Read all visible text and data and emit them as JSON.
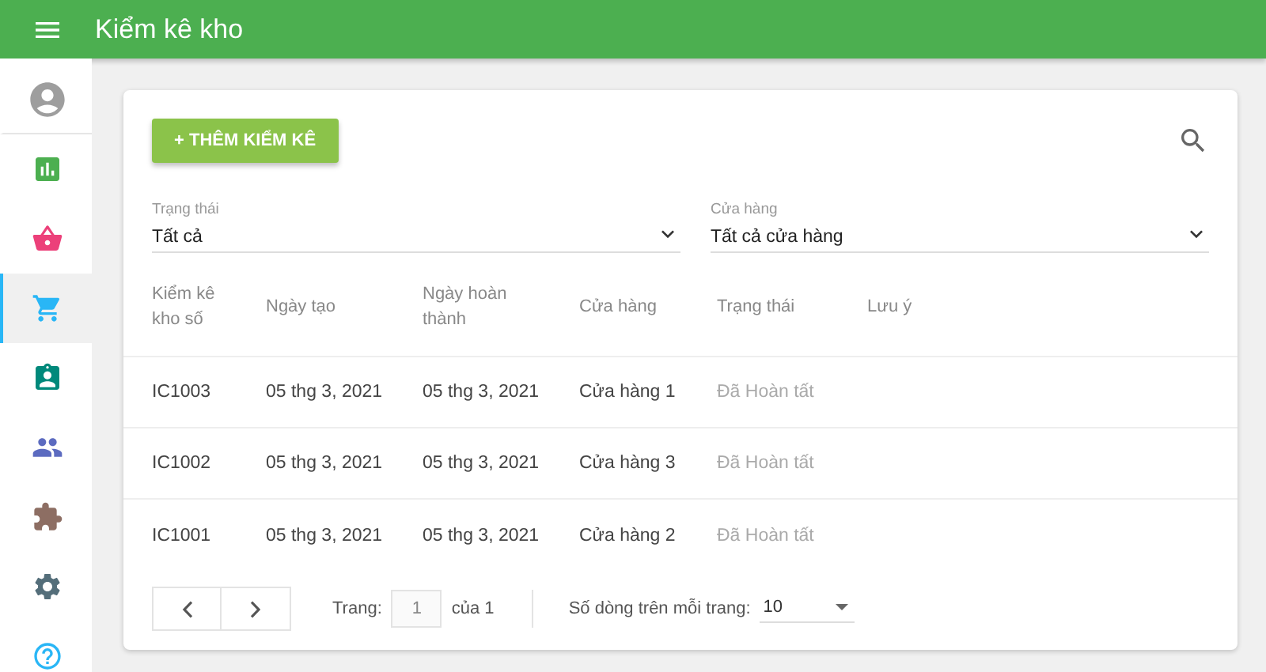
{
  "app_bar": {
    "title": "Kiểm kê kho"
  },
  "sidebar": {
    "items": [
      {
        "kind": "avatar",
        "selected": false,
        "color": "#9e9e9e"
      },
      {
        "kind": "chart",
        "selected": false,
        "color": "#4caf50"
      },
      {
        "kind": "basket",
        "selected": false,
        "color": "#ec407a"
      },
      {
        "kind": "cart",
        "selected": true,
        "color": "#29b6f6"
      },
      {
        "kind": "card",
        "selected": false,
        "color": "#00897b"
      },
      {
        "kind": "people",
        "selected": false,
        "color": "#5c6bc0"
      },
      {
        "kind": "puzzle",
        "selected": false,
        "color": "#8d6e63"
      },
      {
        "kind": "settings",
        "selected": false,
        "color": "#546e7a"
      },
      {
        "kind": "help",
        "selected": false,
        "color": "#29b6f6"
      }
    ]
  },
  "add_button": {
    "label": "+ THÊM KIỂM KÊ"
  },
  "filters": [
    {
      "label": "Trạng thái",
      "value": "Tất cả"
    },
    {
      "label": "Cửa hàng",
      "value": "Tất cả cửa hàng"
    }
  ],
  "table": {
    "columns": [
      "Kiểm kê kho số",
      "Ngày tạo",
      "Ngày hoàn thành",
      "Cửa hàng",
      "Trạng thái",
      "Lưu ý"
    ],
    "rows": [
      [
        "IC1003",
        "05 thg 3, 2021",
        "05 thg 3, 2021",
        "Cửa hàng 1",
        "Đã Hoàn tất",
        ""
      ],
      [
        "IC1002",
        "05 thg 3, 2021",
        "05 thg 3, 2021",
        "Cửa hàng 3",
        "Đã Hoàn tất",
        ""
      ],
      [
        "IC1001",
        "05 thg 3, 2021",
        "05 thg 3, 2021",
        "Cửa hàng 2",
        "Đã Hoàn tất",
        ""
      ]
    ]
  },
  "pagination": {
    "page_label": "Trang:",
    "page": "1",
    "of_label": "của 1",
    "rows_label": "Số dòng trên mỗi trang:",
    "rows_per_page": "10"
  }
}
